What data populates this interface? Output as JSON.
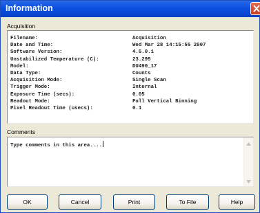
{
  "window": {
    "title": "Information"
  },
  "acquisition": {
    "label": "Acquisition",
    "rows": [
      {
        "key": "Filename:",
        "value": "Acquisition"
      },
      {
        "key": "Date and Time:",
        "value": "Wed Mar 28 14:15:55 2007"
      },
      {
        "key": "Software Version:",
        "value": "4.5.0.1"
      },
      {
        "key": "Unstabilized Temperature (C):",
        "value": "23.295"
      },
      {
        "key": "Model:",
        "value": "DU490_17"
      },
      {
        "key": "Data Type:",
        "value": "Counts"
      },
      {
        "key": "Acquisition Mode:",
        "value": "Single Scan"
      },
      {
        "key": "Trigger Mode:",
        "value": "Internal"
      },
      {
        "key": "Exposure Time (secs):",
        "value": "0.05"
      },
      {
        "key": "Readout Mode:",
        "value": "Full Vertical Binning"
      },
      {
        "key": "Pixel Readout Time (usecs):",
        "value": "0.1"
      }
    ]
  },
  "comments": {
    "label": "Comments",
    "value": "Type comments in this area...."
  },
  "buttons": {
    "ok": "OK",
    "cancel": "Cancel",
    "print": "Print",
    "to_file": "To File",
    "help": "Help"
  },
  "icons": {
    "close": "close-icon",
    "scroll_up": "arrow-up-icon",
    "scroll_down": "arrow-down-icon"
  }
}
